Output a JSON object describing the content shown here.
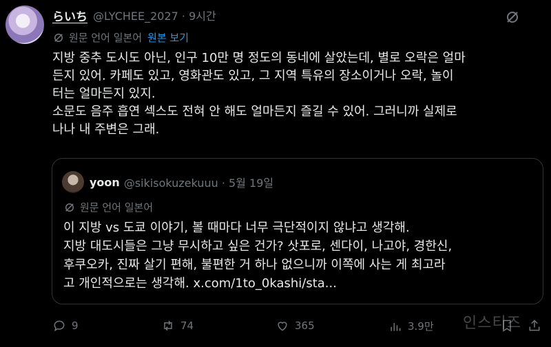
{
  "post": {
    "display_name": "らいち",
    "handle_time": "@LYCHEE_2027 · 9시간",
    "translation_note": "원문 언어 일본어",
    "show_original": "원본 보기",
    "body_lines": [
      "지방 중추 도시도 아닌, 인구 10만 명 정도의 동네에 살았는데, 별로 오락은 얼마",
      "든지 있어. 카페도 있고, 영화관도 있고, 그 지역 특유의 장소이거나 오락, 놀이",
      "터는 얼마든지 있지.",
      "소문도 음주 흡연 섹스도 전혀 안 해도 얼마든지 즐길 수 있어. 그러니까 실제로",
      "나나 내 주변은 그래."
    ]
  },
  "quote": {
    "display_name": "yoon",
    "handle_time": "@sikisokuzekuuu · 5월 19일",
    "translation_note": "원문 언어 일본어",
    "body_lines": [
      "이 지방 vs 도쿄 이야기, 볼 때마다 너무 극단적이지 않냐고 생각해.",
      "지방 대도시들은 그냥 무시하고 싶은 건가? 삿포로, 센다이, 나고야, 경한신,",
      "후쿠오카, 진짜 살기 편해, 불편한 거 하나 없으니까 이쪽에 사는 게 최고라",
      "고 개인적으로는 생각해. x.com/1to_0kashi/sta..."
    ]
  },
  "actions": {
    "replies": "9",
    "reposts": "74",
    "likes": "365",
    "views": "3.9만"
  },
  "watermark": "인스티즈",
  "icons": {
    "more": "grok-icon",
    "translate": "translate-icon",
    "reply": "reply-icon",
    "repost": "repost-icon",
    "like": "heart-icon",
    "views": "views-icon",
    "bookmark": "bookmark-icon",
    "share": "share-icon"
  },
  "colors": {
    "background": "#000000",
    "text": "#e7e9ea",
    "secondary": "#71767b",
    "link": "#1d9bf0",
    "border": "#2f3336"
  }
}
